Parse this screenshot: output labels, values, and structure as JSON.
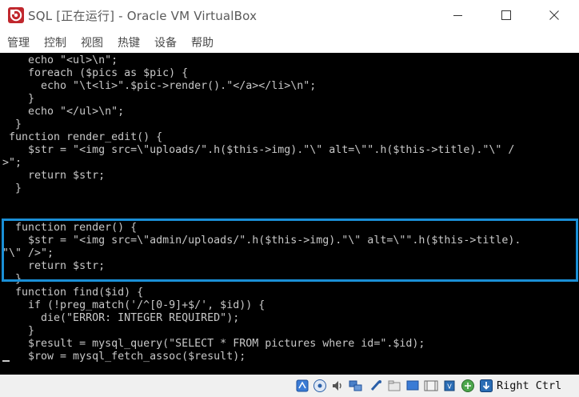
{
  "window": {
    "title": "SQL [正在运行] - Oracle VM VirtualBox",
    "app_icon": "virtualbox-logo",
    "controls": [
      "minimize-icon",
      "maximize-icon",
      "close-icon"
    ]
  },
  "menu": {
    "items": [
      "管理",
      "控制",
      "视图",
      "热键",
      "设备",
      "帮助"
    ]
  },
  "console": {
    "lines": [
      "    echo \"<ul>\\n\";",
      "    foreach ($pics as $pic) {",
      "      echo \"\\t<li>\".$pic->render().\"</a></li>\\n\";",
      "    }",
      "    echo \"</ul>\\n\";",
      "  }",
      " function render_edit() {",
      "    $str = \"<img src=\\\"uploads/\".h($this->img).\"\\\" alt=\\\"\".h($this->title).\"\\\" /",
      ">\";",
      "    return $str;",
      "  }",
      "",
      "  function render() {",
      "    $str = \"<img src=\\\"admin/uploads/\".h($this->img).\"\\\" alt=\\\"\".h($this->title).",
      "\"\\\" />\";",
      "    return $str;",
      "  }",
      "  function find($id) {",
      "    if (!preg_match('/^[0-9]+$/', $id)) {",
      "      die(\"ERROR: INTEGER REQUIRED\");",
      "    }",
      "    $result = mysql_query(\"SELECT * FROM pictures where id=\".$id);",
      "    $row = mysql_fetch_assoc($result);"
    ],
    "highlight_color": "#1a8fd6"
  },
  "statusbar": {
    "icons": [
      "hard-disk-icon",
      "optical-disk-icon",
      "audio-icon",
      "network-icon",
      "usb-icon",
      "shared-folder-icon",
      "display-icon",
      "video-capture-icon",
      "cpu-icon",
      "mouse-integration-icon",
      "down-arrow-icon"
    ],
    "host_key": "Right Ctrl"
  }
}
